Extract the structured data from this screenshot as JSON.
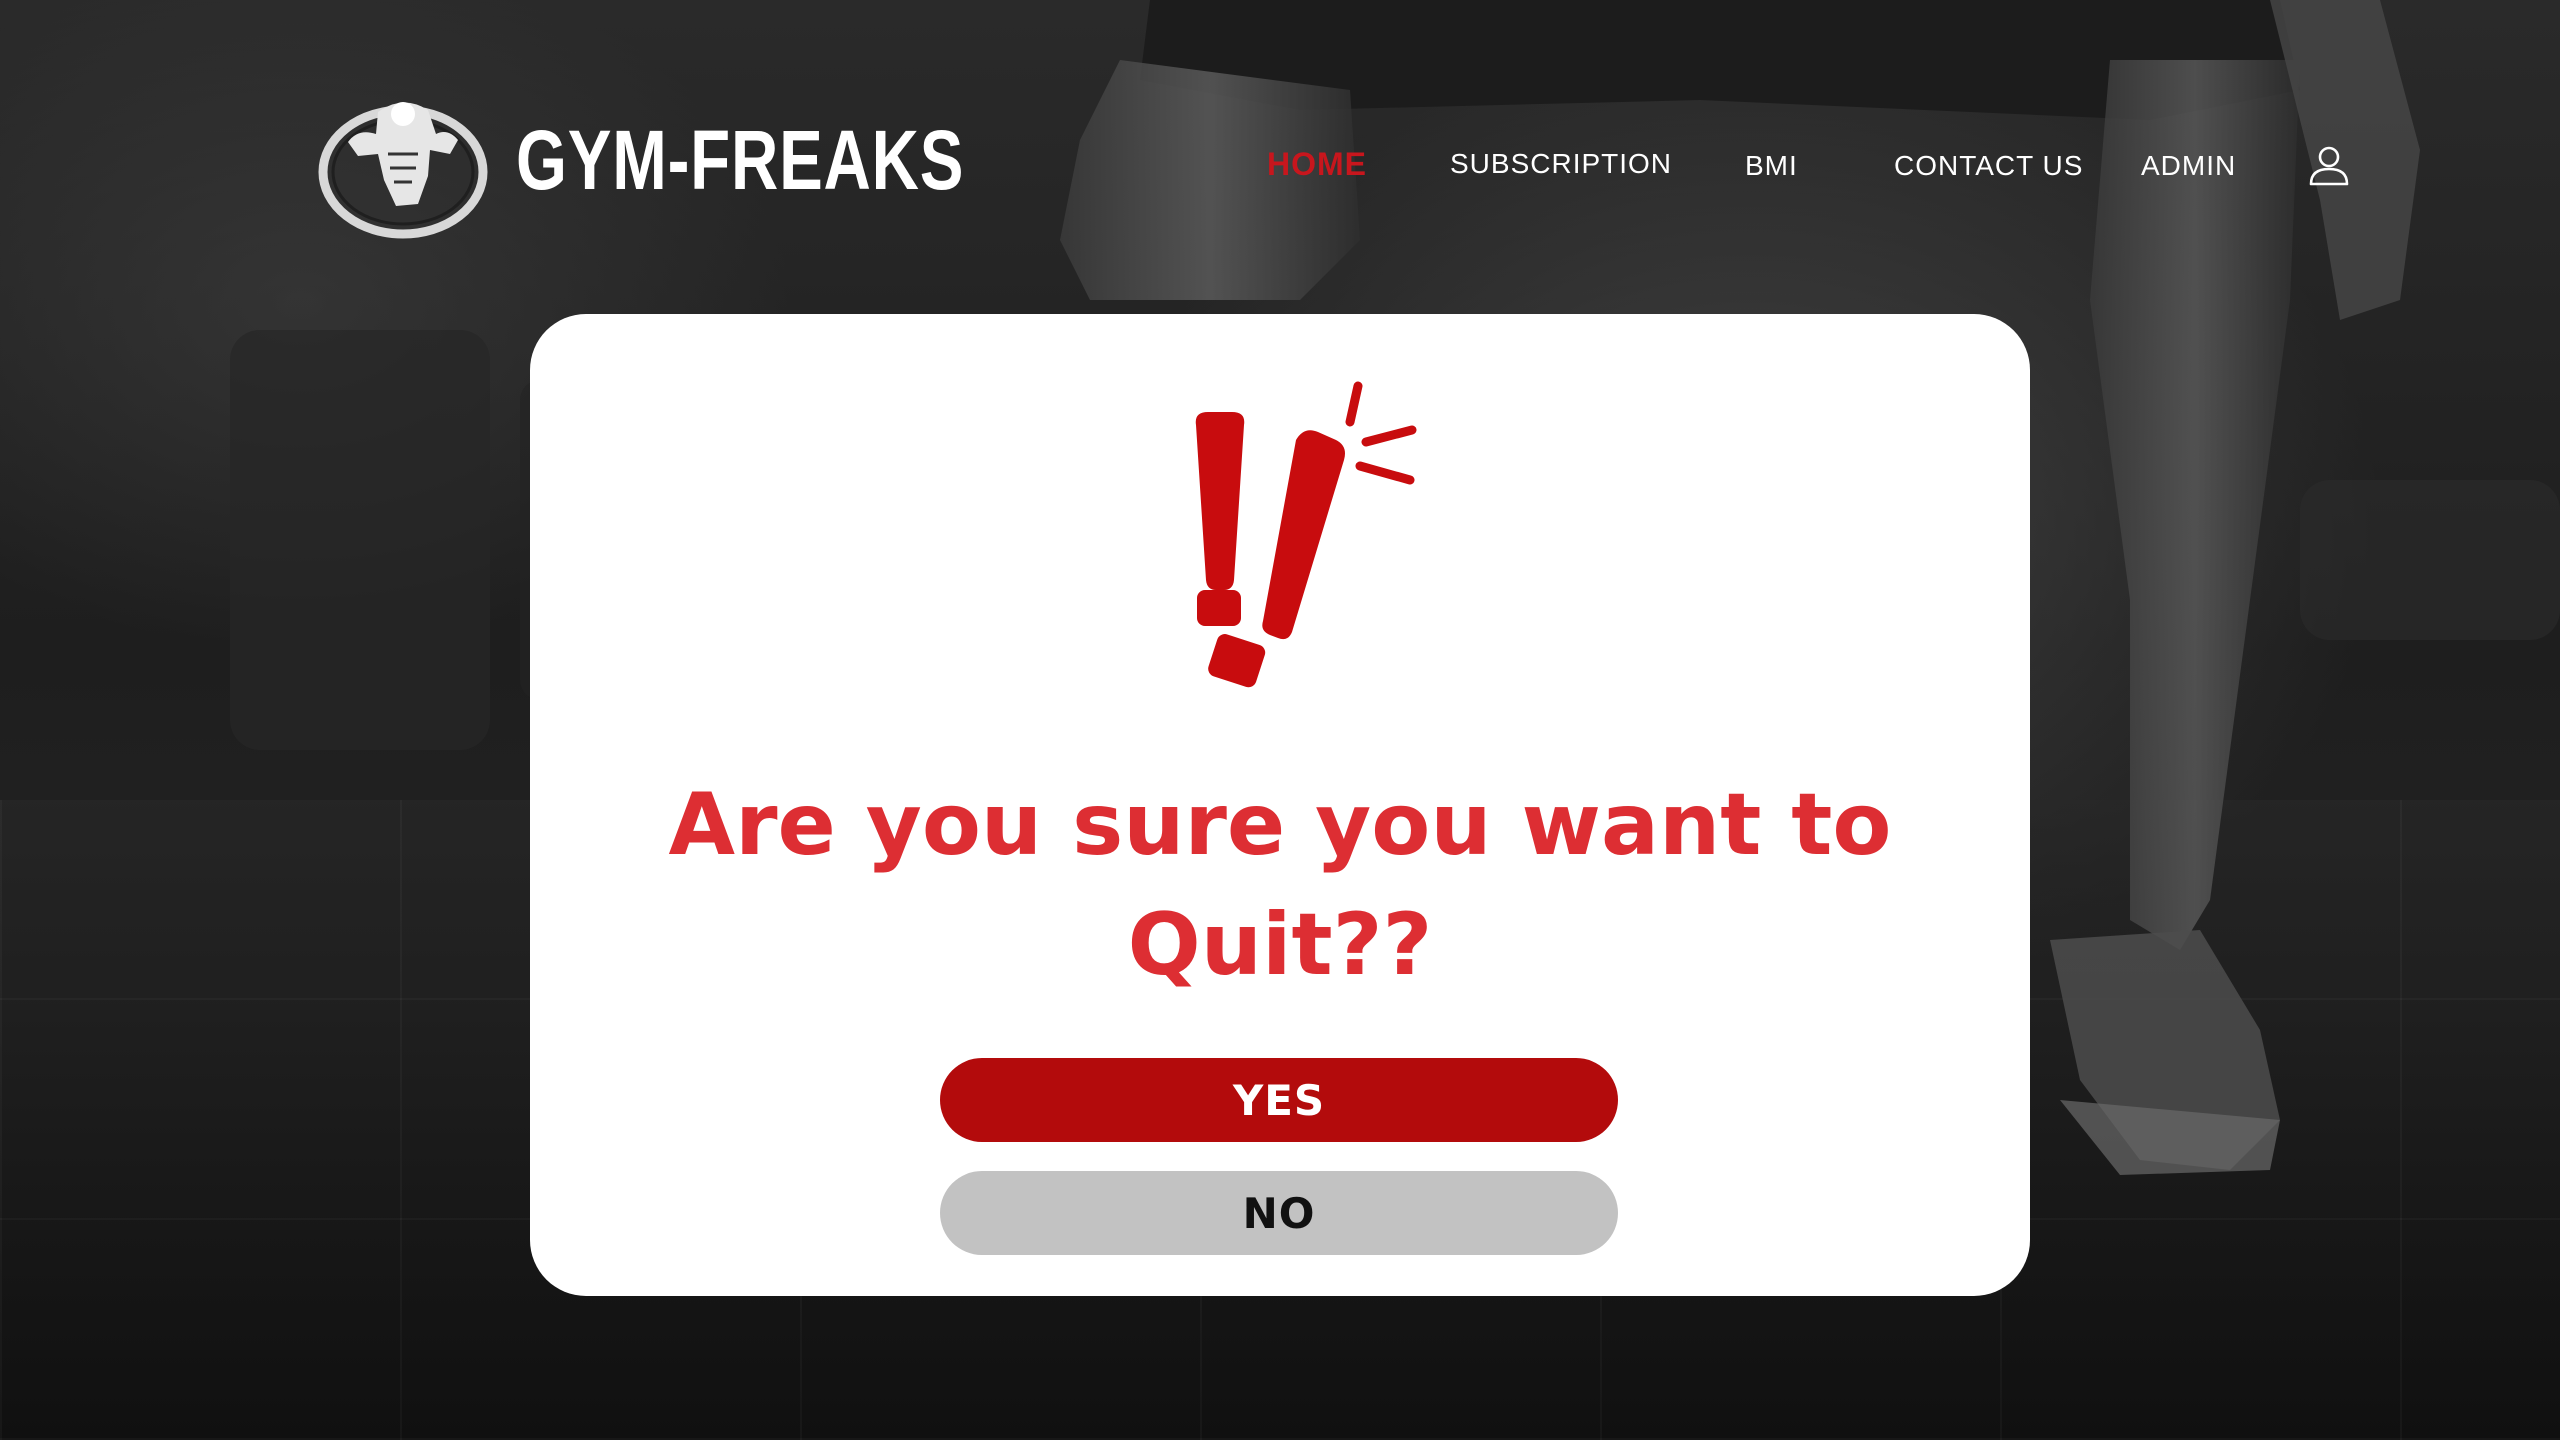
{
  "brand": {
    "name": "GYM-FREAKS",
    "logo_icon": "bodybuilder-logo-icon"
  },
  "nav": {
    "items": [
      {
        "label": "HOME",
        "active": true
      },
      {
        "label": "SUBSCRIPTION",
        "active": false
      },
      {
        "label": "BMI",
        "active": false
      },
      {
        "label": "CONTACT US",
        "active": false
      },
      {
        "label": "ADMIN",
        "active": false
      }
    ],
    "user_icon": "user-icon"
  },
  "dialog": {
    "icon": "exclamation-alert-icon",
    "question": "Are you sure you want to Quit??",
    "yes_label": "YES",
    "no_label": "NO"
  },
  "colors": {
    "accent_red": "#c8161d",
    "question_red": "#dd2e33",
    "yes_button": "#b30b0c",
    "no_button": "#c2c2c2",
    "modal_bg": "#ffffff"
  }
}
